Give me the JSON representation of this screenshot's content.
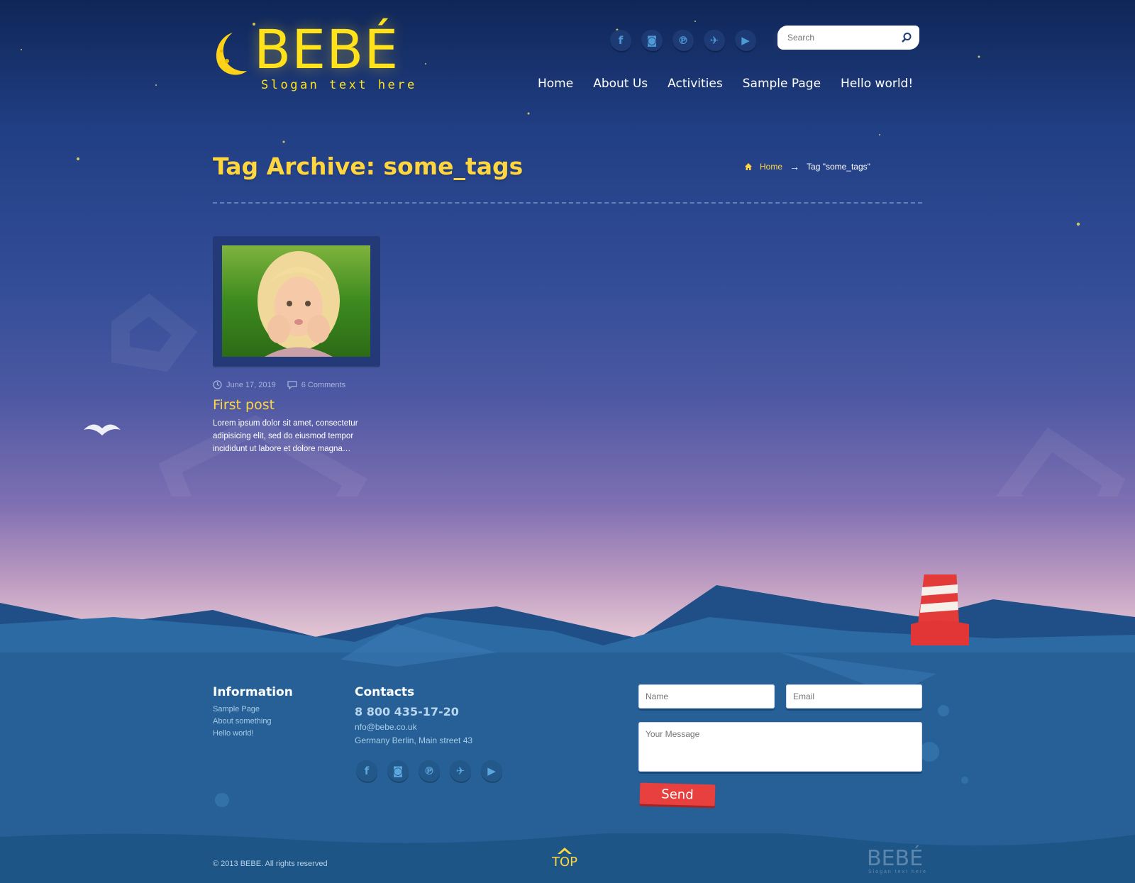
{
  "brand": {
    "name": "BEBÉ",
    "slogan": "Slogan text here"
  },
  "header": {
    "social_icons": [
      "facebook-icon",
      "instagram-icon",
      "pinterest-icon",
      "twitter-icon",
      "youtube-icon"
    ],
    "search": {
      "placeholder": "Search"
    },
    "nav": [
      "Home",
      "About Us",
      "Activities",
      "Sample Page",
      "Hello world!"
    ]
  },
  "page": {
    "title": "Tag Archive: some_tags",
    "breadcrumb": {
      "home": "Home",
      "separator": "→",
      "current": "Tag \"some_tags\""
    }
  },
  "post": {
    "date": "June 17, 2019",
    "comments": "6 Comments",
    "title": "First post",
    "excerpt": "Lorem ipsum dolor sit amet, consectetur adipisicing elit, sed do eiusmod tempor incididunt ut labore et dolore magna…"
  },
  "footer": {
    "information": {
      "heading": "Information",
      "links": [
        "Sample Page",
        "About something",
        "Hello world!"
      ]
    },
    "contacts": {
      "heading": "Contacts",
      "phone": "8 800 435-17-20",
      "email": "nfo@bebe.co.uk",
      "address": "Germany Berlin, Main street 43"
    },
    "form": {
      "name_placeholder": "Name",
      "email_placeholder": "Email",
      "message_placeholder": "Your Message",
      "send_label": "Send"
    },
    "copyright": "© 2013 BEBE. All rights reserved",
    "top_label": "TOP",
    "mini_logo": "BEBÉ",
    "mini_slogan": "Slogan text here"
  },
  "colors": {
    "accent_yellow": "#ffd640",
    "send_red": "#e8403e",
    "sky_top": "#0f2657",
    "sea": "#2b679b"
  }
}
